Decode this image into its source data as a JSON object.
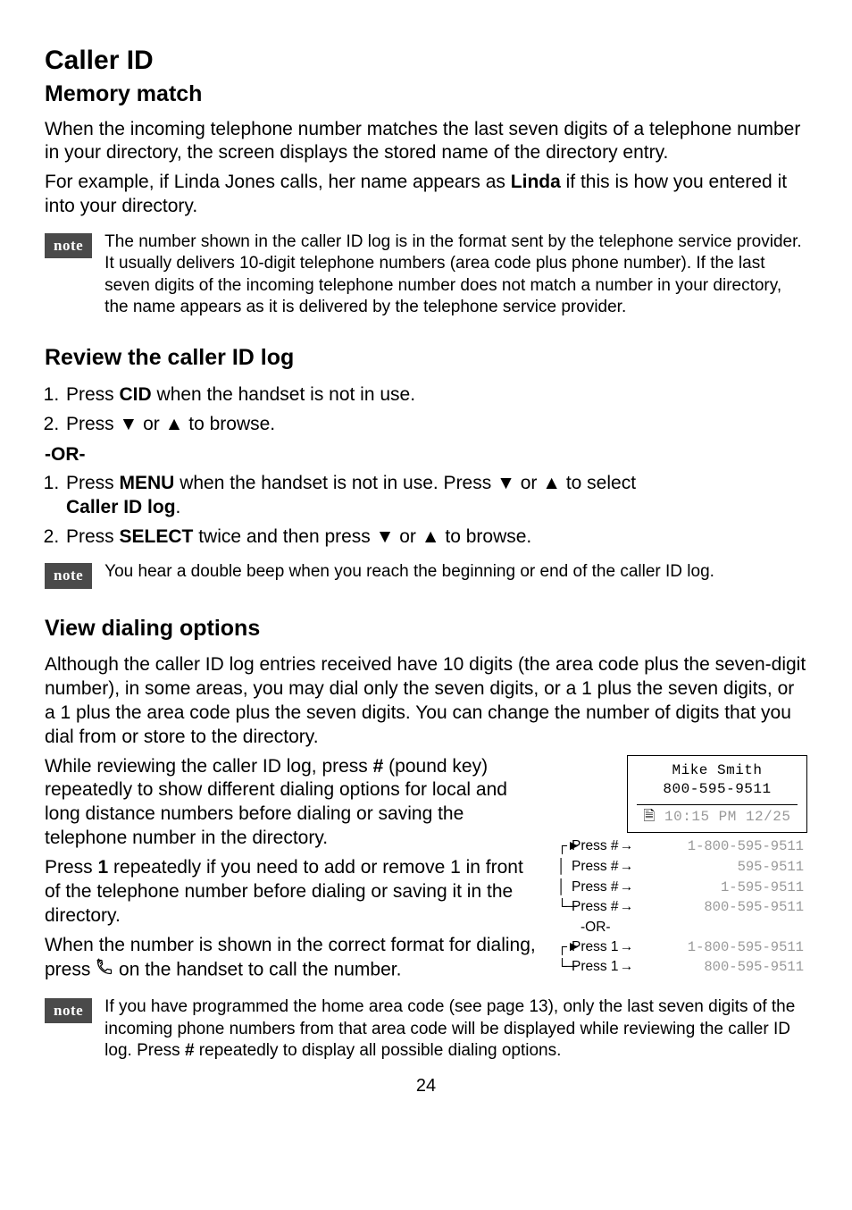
{
  "title": "Caller ID",
  "subtitle": "Memory match",
  "intro1": "When the incoming telephone number matches the last seven digits of a telephone number in your directory, the screen displays the stored name of the directory entry.",
  "intro2_a": "For example, if Linda Jones calls, her name appears as ",
  "intro2_bold": "Linda",
  "intro2_b": " if this is how you entered it into your directory.",
  "note_label": "note",
  "note1": "The number shown in the caller ID log is in the format sent by the telephone service provider. It usually delivers 10-digit telephone numbers (area code plus phone number). If the last seven digits of the incoming telephone number does not match a number in your directory, the name appears as it is delivered by the telephone service provider.",
  "review_heading": "Review the caller ID log",
  "review_step1_a": "Press ",
  "review_step1_bold": "CID",
  "review_step1_b": " when the handset is not in use.",
  "review_step2": "Press ▼ or ▲ to browse.",
  "or_label": "-OR-",
  "review_alt1_a": "Press ",
  "review_alt1_bold1": "MENU",
  "review_alt1_b": " when the handset is not in use. Press ▼ or ▲ to select ",
  "review_alt1_bold2": "Caller ID log",
  "review_alt1_c": ".",
  "review_alt2_a": "Press ",
  "review_alt2_bold": "SELECT",
  "review_alt2_b": " twice and then press ▼ or ▲ to browse.",
  "note2": "You hear a double beep when you reach the beginning or end of the caller ID log.",
  "view_heading": "View dialing options",
  "view_p1": "Although the caller ID log entries received have 10 digits (the area code plus the seven-digit number), in some areas, you may dial only the seven digits, or a 1 plus the seven digits, or a 1 plus the area code plus the seven digits. You can change the number of digits that you dial from or store to the directory.",
  "view_p2_a": "While reviewing the caller ID log, press ",
  "view_p2_bold": "#",
  "view_p2_b": " (pound key) repeatedly to show different dialing options for local and long distance numbers before dialing or saving the telephone number in the directory.",
  "view_p3_a": "Press ",
  "view_p3_bold": "1",
  "view_p3_b": " repeatedly if you need to add or remove 1 in front of the telephone number before dialing or saving it in the directory.",
  "view_p4_a": "When the number is shown in the correct format for dialing, press ",
  "view_p4_b": " on the handset to call the number.",
  "diagram": {
    "screen_name": "Mike Smith",
    "screen_number": "800-595-9511",
    "screen_time": "10:15 PM  12/25",
    "press_hash": "Press #",
    "press_1": "Press 1",
    "or": "-OR-",
    "opt_hash": [
      "1-800-595-9511",
      "595-9511",
      "1-595-9511",
      "800-595-9511"
    ],
    "opt_1": [
      "1-800-595-9511",
      "800-595-9511"
    ]
  },
  "note3_a": "If you have programmed the home area code (see page 13), only the last seven digits of the incoming phone numbers from that area code will be displayed while reviewing the caller ID log. Press ",
  "note3_bold": "#",
  "note3_b": " repeatedly to display all possible dialing options.",
  "page_number": "24"
}
